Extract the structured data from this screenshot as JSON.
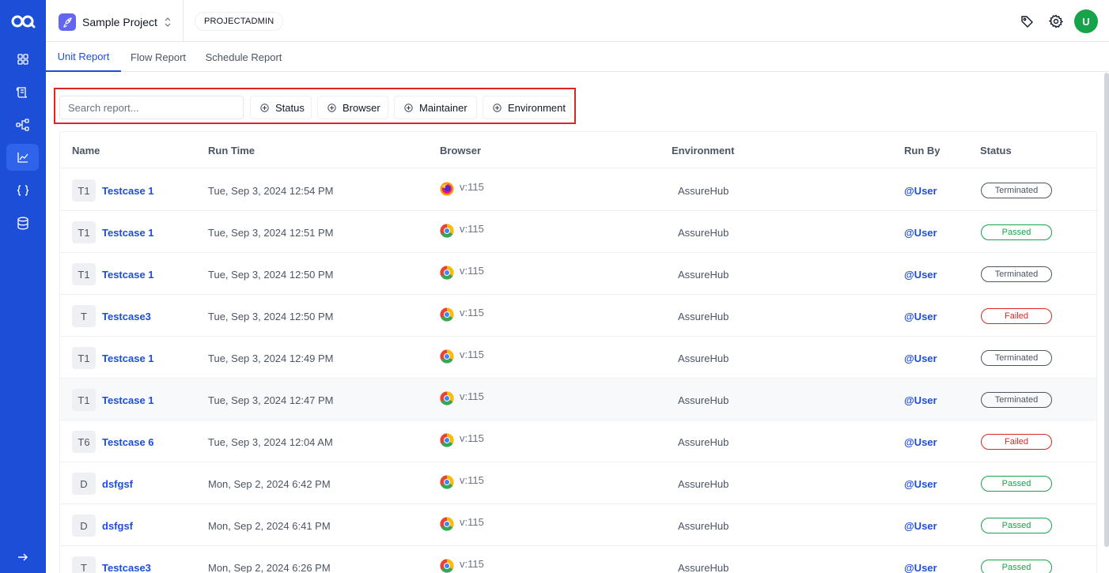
{
  "project": {
    "name": "Sample Project",
    "role": "PROJECTADMIN"
  },
  "user": {
    "initial": "U"
  },
  "nav": {
    "items": [
      "dashboard",
      "test-cases",
      "flows",
      "reports",
      "variables",
      "data"
    ],
    "active": "reports"
  },
  "tabs": [
    {
      "label": "Unit Report",
      "active": true
    },
    {
      "label": "Flow Report",
      "active": false
    },
    {
      "label": "Schedule Report",
      "active": false
    }
  ],
  "filters": {
    "search_placeholder": "Search report...",
    "buttons": [
      "Status",
      "Browser",
      "Maintainer",
      "Environment"
    ]
  },
  "table": {
    "headers": [
      "Name",
      "Run Time",
      "Browser",
      "Environment",
      "Run By",
      "Status"
    ],
    "rows": [
      {
        "initial": "T1",
        "name": "Testcase 1",
        "run_time": "Tue, Sep 3, 2024 12:54 PM",
        "browser": "firefox",
        "version": "v:115",
        "environment": "AssureHub",
        "run_by": "@User",
        "status": "Terminated"
      },
      {
        "initial": "T1",
        "name": "Testcase 1",
        "run_time": "Tue, Sep 3, 2024 12:51 PM",
        "browser": "chrome",
        "version": "v:115",
        "environment": "AssureHub",
        "run_by": "@User",
        "status": "Passed"
      },
      {
        "initial": "T1",
        "name": "Testcase 1",
        "run_time": "Tue, Sep 3, 2024 12:50 PM",
        "browser": "chrome",
        "version": "v:115",
        "environment": "AssureHub",
        "run_by": "@User",
        "status": "Terminated"
      },
      {
        "initial": "T",
        "name": "Testcase3",
        "run_time": "Tue, Sep 3, 2024 12:50 PM",
        "browser": "chrome",
        "version": "v:115",
        "environment": "AssureHub",
        "run_by": "@User",
        "status": "Failed"
      },
      {
        "initial": "T1",
        "name": "Testcase 1",
        "run_time": "Tue, Sep 3, 2024 12:49 PM",
        "browser": "chrome",
        "version": "v:115",
        "environment": "AssureHub",
        "run_by": "@User",
        "status": "Terminated"
      },
      {
        "initial": "T1",
        "name": "Testcase 1",
        "run_time": "Tue, Sep 3, 2024 12:47 PM",
        "browser": "chrome",
        "version": "v:115",
        "environment": "AssureHub",
        "run_by": "@User",
        "status": "Terminated",
        "highlighted": true
      },
      {
        "initial": "T6",
        "name": "Testcase 6",
        "run_time": "Tue, Sep 3, 2024 12:04 AM",
        "browser": "chrome",
        "version": "v:115",
        "environment": "AssureHub",
        "run_by": "@User",
        "status": "Failed"
      },
      {
        "initial": "D",
        "name": "dsfgsf",
        "run_time": "Mon, Sep 2, 2024 6:42 PM",
        "browser": "chrome",
        "version": "v:115",
        "environment": "AssureHub",
        "run_by": "@User",
        "status": "Passed"
      },
      {
        "initial": "D",
        "name": "dsfgsf",
        "run_time": "Mon, Sep 2, 2024 6:41 PM",
        "browser": "chrome",
        "version": "v:115",
        "environment": "AssureHub",
        "run_by": "@User",
        "status": "Passed"
      },
      {
        "initial": "T",
        "name": "Testcase3",
        "run_time": "Mon, Sep 2, 2024 6:26 PM",
        "browser": "chrome",
        "version": "v:115",
        "environment": "AssureHub",
        "run_by": "@User",
        "status": "Passed"
      }
    ]
  },
  "colors": {
    "brand": "#1d4ed8",
    "passed": "#16a34a",
    "failed": "#dc2626",
    "terminated": "#4b5563",
    "highlight_frame": "#dc2626"
  }
}
